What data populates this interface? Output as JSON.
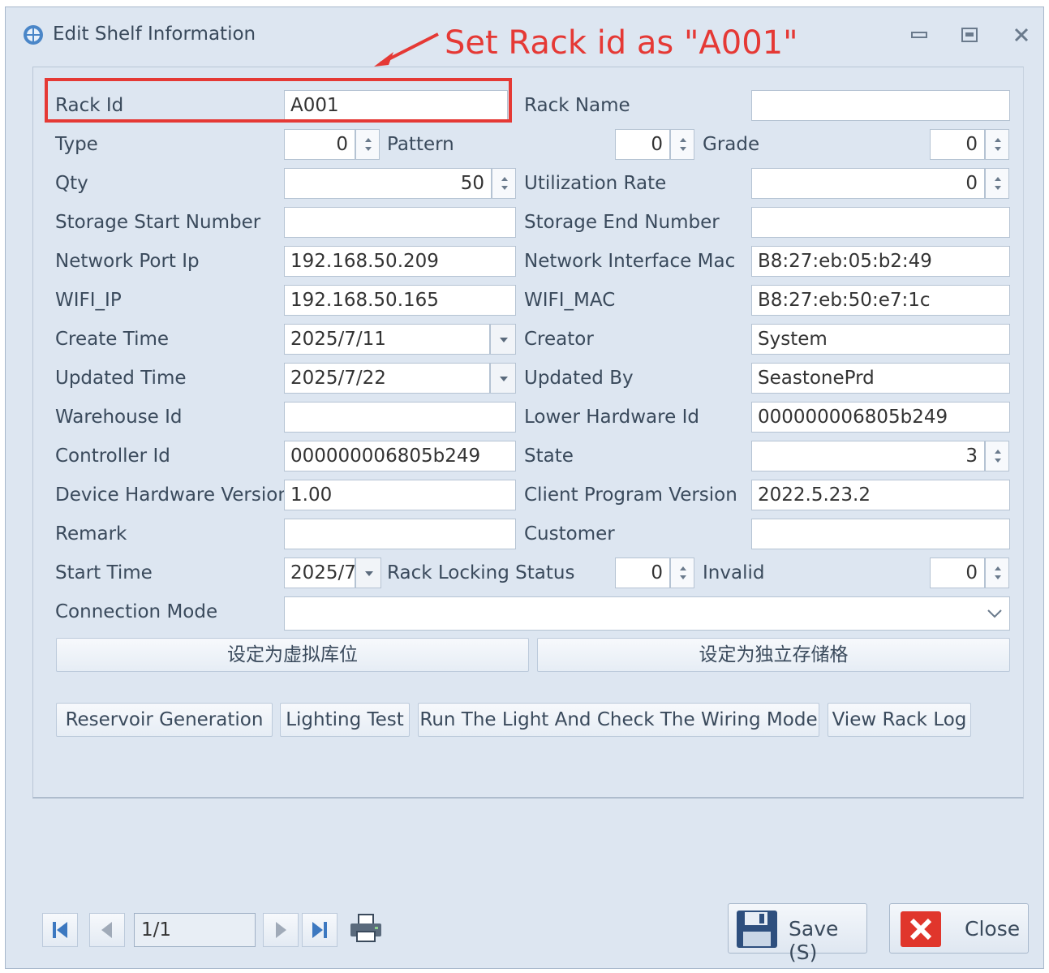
{
  "window": {
    "title": "Edit Shelf Information"
  },
  "annotation": {
    "text": "Set Rack id as \"A001\""
  },
  "fields": {
    "rack_id": {
      "label": "Rack Id",
      "value": "A001"
    },
    "rack_name": {
      "label": "Rack Name",
      "value": ""
    },
    "type": {
      "label": "Type",
      "value": "0"
    },
    "pattern": {
      "label": "Pattern",
      "value": "0"
    },
    "grade": {
      "label": "Grade",
      "value": "0"
    },
    "qty": {
      "label": "Qty",
      "value": "50"
    },
    "utilization_rate": {
      "label": "Utilization Rate",
      "value": "0"
    },
    "storage_start_number": {
      "label": "Storage Start Number",
      "value": ""
    },
    "storage_end_number": {
      "label": "Storage End Number",
      "value": ""
    },
    "network_port_ip": {
      "label": "Network Port Ip",
      "value": "192.168.50.209"
    },
    "network_interface_mac": {
      "label": "Network Interface Mac",
      "value": "B8:27:eb:05:b2:49"
    },
    "wifi_ip": {
      "label": "WIFI_IP",
      "value": "192.168.50.165"
    },
    "wifi_mac": {
      "label": "WIFI_MAC",
      "value": "B8:27:eb:50:e7:1c"
    },
    "create_time": {
      "label": "Create Time",
      "value": "2025/7/11"
    },
    "creator": {
      "label": "Creator",
      "value": "System"
    },
    "updated_time": {
      "label": "Updated Time",
      "value": "2025/7/22"
    },
    "updated_by": {
      "label": "Updated By",
      "value": "SeastonePrd"
    },
    "warehouse_id": {
      "label": "Warehouse Id",
      "value": ""
    },
    "lower_hardware_id": {
      "label": "Lower Hardware Id",
      "value": "000000006805b249"
    },
    "controller_id": {
      "label": "Controller Id",
      "value": "000000006805b249"
    },
    "state": {
      "label": "State",
      "value": "3"
    },
    "device_hardware_version": {
      "label": "Device Hardware Version",
      "value": "1.00"
    },
    "client_program_version": {
      "label": "Client Program Version",
      "value": "2022.5.23.2"
    },
    "remark": {
      "label": "Remark",
      "value": ""
    },
    "customer": {
      "label": "Customer",
      "value": ""
    },
    "start_time": {
      "label": "Start Time",
      "value": "2025/7"
    },
    "rack_locking_status": {
      "label": "Rack Locking Status",
      "value": "0"
    },
    "invalid": {
      "label": "Invalid",
      "value": "0"
    },
    "connection_mode": {
      "label": "Connection Mode",
      "value": ""
    }
  },
  "buttons": {
    "set_virtual": "设定为虚拟库位",
    "set_independent": "设定为独立存储格",
    "reservoir_generation": "Reservoir Generation",
    "lighting_test": "Lighting Test",
    "run_light": "Run The Light And Check The Wiring Mode",
    "view_rack_log": "View Rack Log",
    "save": "Save (S)",
    "close": "Close"
  },
  "pager": {
    "text": "1/1"
  },
  "icons": [
    "app-icon",
    "minimize-icon",
    "maximize-icon",
    "close-window-icon",
    "first-page-icon",
    "prev-page-icon",
    "next-page-icon",
    "last-page-icon",
    "print-icon",
    "save-disk-icon",
    "close-x-icon"
  ],
  "colors": {
    "background": "#dde6f1",
    "annotation": "#e53935"
  }
}
